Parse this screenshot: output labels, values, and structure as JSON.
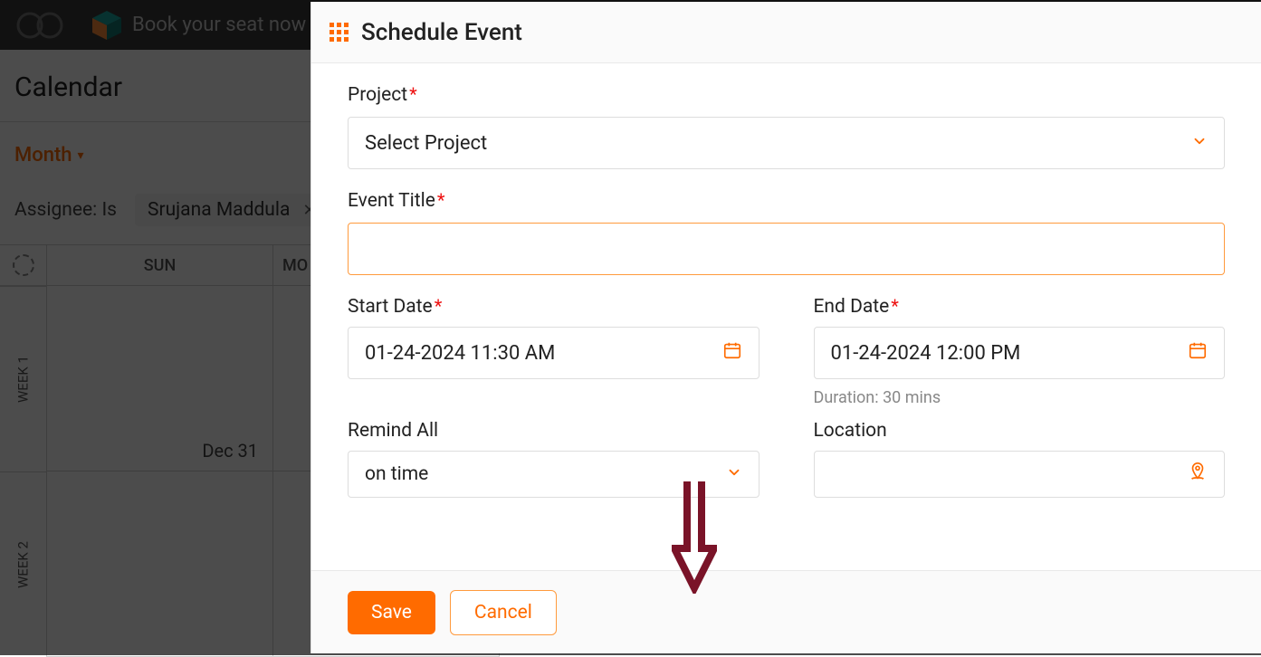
{
  "banner": {
    "text": "Book your seat now"
  },
  "page": {
    "title": "Calendar",
    "view": "Month",
    "filter_label": "Assignee: Is",
    "filter_value": "Srujana Maddula"
  },
  "grid": {
    "day_headers": [
      "SUN",
      "MO"
    ],
    "weeks": [
      "WEEK 1",
      "WEEK 2"
    ],
    "dates": {
      "w1d1": "Dec 31"
    }
  },
  "modal": {
    "title": "Schedule Event",
    "project_label": "Project",
    "project_placeholder": "Select Project",
    "event_title_label": "Event Title",
    "start_label": "Start Date",
    "start_value": "01-24-2024 11:30 AM",
    "end_label": "End Date",
    "end_value": "01-24-2024 12:00 PM",
    "duration_text": "Duration: 30 mins",
    "remind_label": "Remind All",
    "remind_value": "on time",
    "location_label": "Location",
    "save": "Save",
    "cancel": "Cancel"
  }
}
